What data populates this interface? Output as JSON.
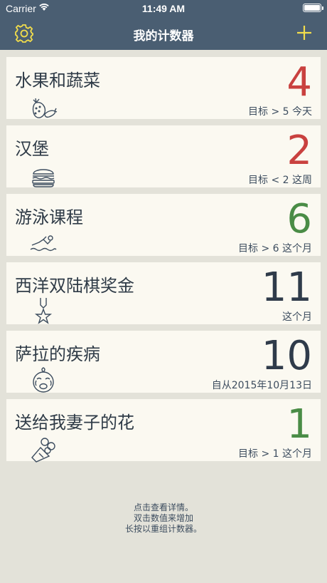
{
  "status_bar": {
    "carrier": "Carrier",
    "time": "11:49 AM"
  },
  "nav": {
    "title": "我的计数器",
    "settings_icon": "gear-icon",
    "add_icon": "plus-icon"
  },
  "colors": {
    "red": "#c9413f",
    "green": "#4a8c46",
    "navy": "#2f3b4a",
    "nav_bg": "#4a5e72",
    "accent": "#f2dd4b"
  },
  "counters": [
    {
      "name": "水果和蔬菜",
      "count": "4",
      "goal": "目标 > 5 今天",
      "icon": "fruit-vegetable-icon",
      "color": "#c9413f"
    },
    {
      "name": "汉堡",
      "count": "2",
      "goal": "目标 < 2 这周",
      "icon": "burger-icon",
      "color": "#c9413f"
    },
    {
      "name": "游泳课程",
      "count": "6",
      "goal": "目标 > 6 这个月",
      "icon": "swimmer-icon",
      "color": "#4a8c46"
    },
    {
      "name": "西洋双陆棋奖金",
      "count": "11",
      "goal": "这个月",
      "icon": "medal-star-icon",
      "color": "#2f3b4a"
    },
    {
      "name": "萨拉的疾病",
      "count": "10",
      "goal": "自从2015年10月13日",
      "icon": "crying-baby-icon",
      "color": "#2f3b4a"
    },
    {
      "name": "送给我妻子的花",
      "count": "1",
      "goal": "目标 > 1 这个月",
      "icon": "flower-bouquet-icon",
      "color": "#4a8c46"
    }
  ],
  "hint": {
    "line1": "点击查看详情。",
    "line2": "双击数值来增加",
    "line3": "长按以重组计数器。"
  }
}
